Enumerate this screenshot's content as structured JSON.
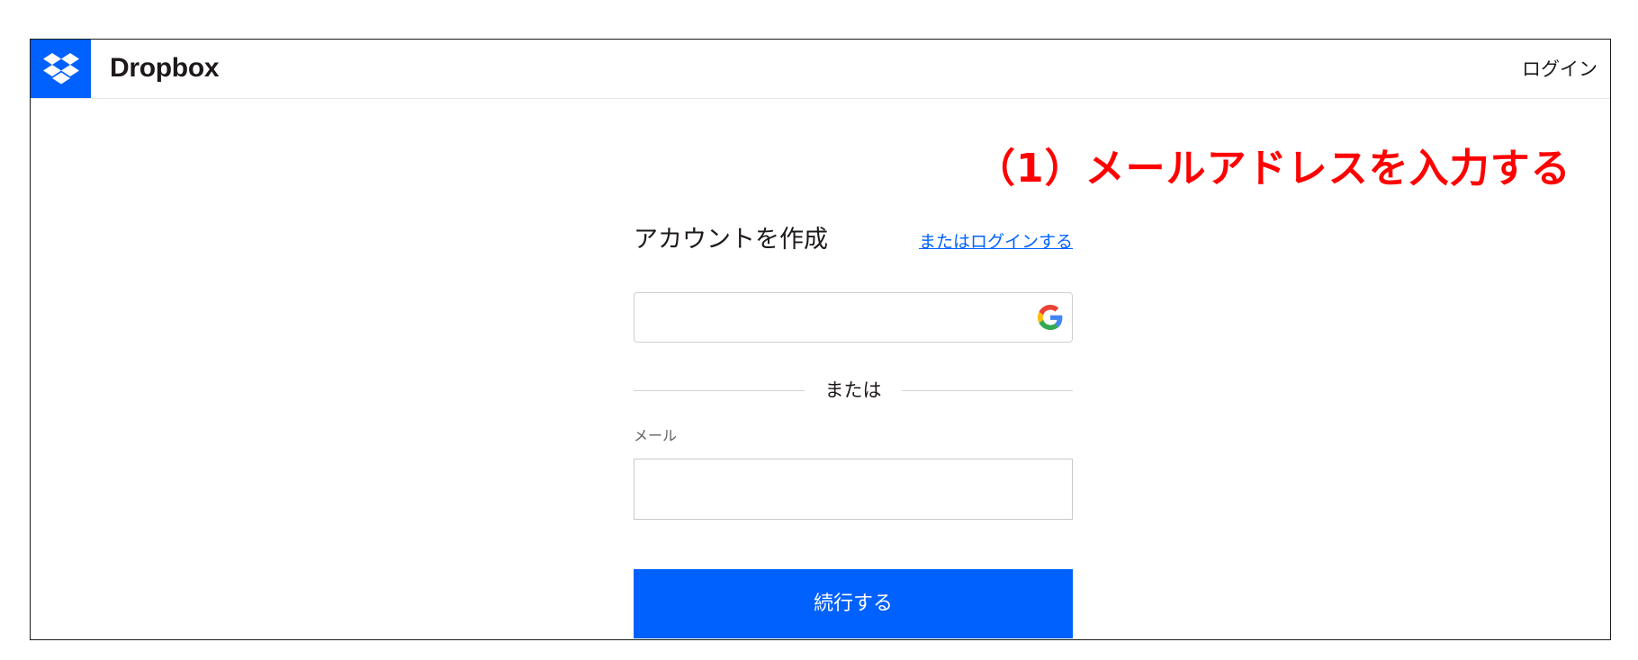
{
  "header": {
    "brand": "Dropbox",
    "login_label": "ログイン",
    "logo_icon": "dropbox-logo-icon",
    "brand_color": "#0061fe"
  },
  "annotation": {
    "text": "（1）メールアドレスを入力する",
    "color": "#ff0000"
  },
  "form": {
    "title": "アカウントを作成",
    "login_alt_label": "またはログインする",
    "google_icon": "google-icon",
    "divider_text": "または",
    "email_label": "メール",
    "email_value": "",
    "email_placeholder": "",
    "continue_label": "続行する"
  }
}
